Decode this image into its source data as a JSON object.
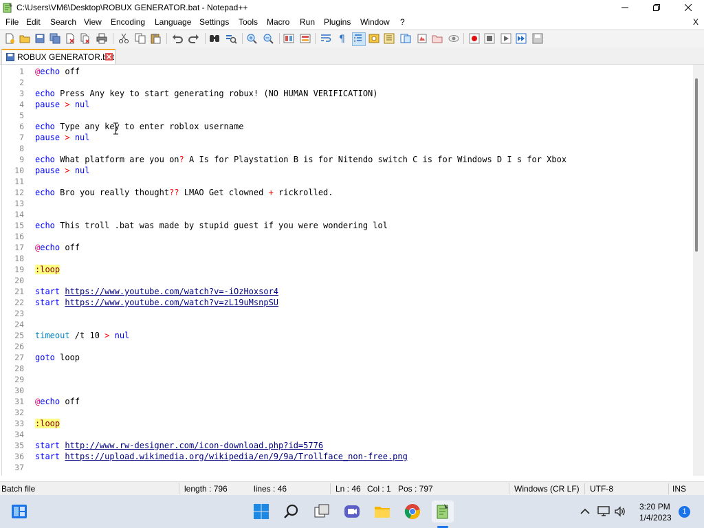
{
  "window": {
    "title": "C:\\Users\\VM6\\Desktop\\ROBUX GENERATOR.bat - Notepad++",
    "close_doc_label": "X"
  },
  "menu": [
    "File",
    "Edit",
    "Search",
    "View",
    "Encoding",
    "Language",
    "Settings",
    "Tools",
    "Macro",
    "Run",
    "Plugins",
    "Window",
    "?"
  ],
  "tab": {
    "label": "ROBUX GENERATOR.bat"
  },
  "editor": {
    "line_numbers": [
      "1",
      "2",
      "3",
      "4",
      "5",
      "6",
      "7",
      "8",
      "9",
      "10",
      "11",
      "12",
      "13",
      "14",
      "15",
      "16",
      "17",
      "18",
      "19",
      "20",
      "21",
      "22",
      "23",
      "24",
      "25",
      "26",
      "27",
      "28",
      "29",
      "30",
      "31",
      "32",
      "33",
      "34",
      "35",
      "36",
      "37"
    ]
  },
  "code": {
    "l1": "echo",
    "l1b": " off",
    "l3a": "echo",
    "l3b": " Press Any key to start generating robux! (NO HUMAN VERIFICATION)",
    "l4a": "pause",
    "l4b": " > ",
    "l4c": "nul",
    "l6a": "echo",
    "l6b": " Type any key to enter roblox username",
    "l7a": "pause",
    "l7b": " > ",
    "l7c": "nul",
    "l9a": "echo",
    "l9b": " What platform are you on",
    "l9c": "?",
    "l9d": " A Is for Playstation B is for Nitendo switch C is for Windows D I s for Xbox",
    "l10a": "pause",
    "l10b": " > ",
    "l10c": "nul",
    "l12a": "echo",
    "l12b": " Bro you really thought",
    "l12c": "??",
    "l12d": " LMAO Get clowned ",
    "l12e": "+",
    "l12f": " rickrolled.",
    "l15a": "echo",
    "l15b": " This troll .bat was made by stupid guest if you were wondering lol",
    "l17a": "echo",
    "l17b": " off",
    "l19": ":loop",
    "l21a": "start",
    "l21b": "https://www.youtube.com/watch",
    "l21c": "?",
    "l21d": "v=-iOzHoxsor4",
    "l22a": "start",
    "l22b": "https://www.youtube.com/watch",
    "l22c": "?",
    "l22d": "v=zL19uMsnpSU",
    "l25a": "timeout",
    "l25b": " /t 10 ",
    "l25c": ">",
    "l25d": " nul",
    "l27a": "goto",
    "l27b": " loop",
    "l31a": "echo",
    "l31b": " off",
    "l33": ":loop",
    "l35a": "start",
    "l35b": "http://www.rw-designer.com/icon-download.php",
    "l35c": "?",
    "l35d": "id=5776",
    "l36a": "start",
    "l36b": "https://upload.wikimedia.org/wikipedia/en/9/9a/Trollface_non-free.png",
    "at": "@"
  },
  "status": {
    "type": "Batch file",
    "length": "length : 796",
    "lines": "lines : 46",
    "ln": "Ln : 46",
    "col": "Col : 1",
    "pos": "Pos : 797",
    "eol": "Windows (CR LF)",
    "encoding": "UTF-8",
    "mode": "INS"
  },
  "taskbar": {
    "time": "3:20 PM",
    "date": "1/4/2023",
    "notification_count": "1"
  },
  "colors": {
    "keyword": "#0000ff",
    "at_sign": "#e1007f",
    "operator": "#ff0000",
    "label_bg": "#ffff80",
    "tab_accent": "#f5a623"
  }
}
